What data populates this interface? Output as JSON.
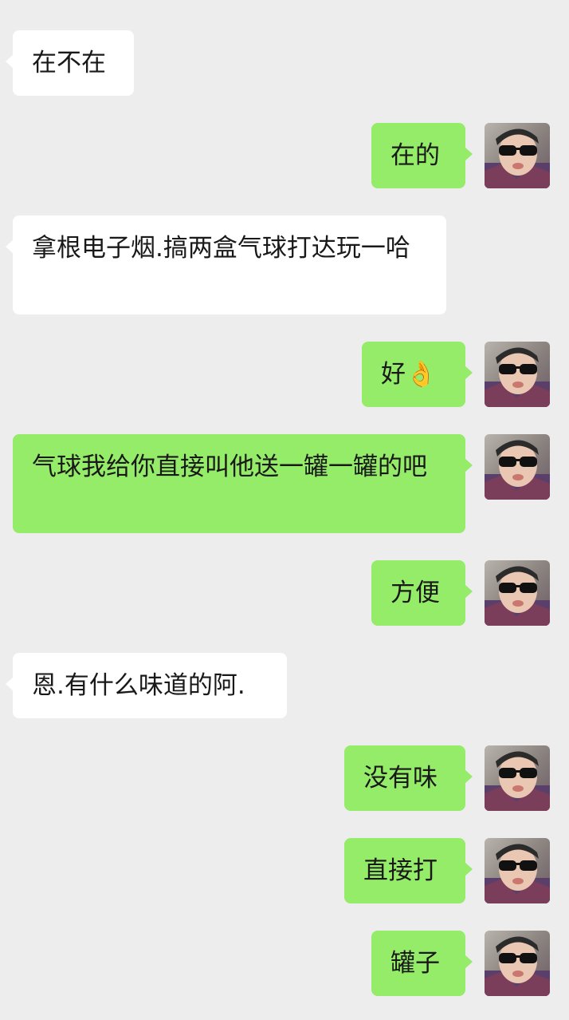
{
  "messages": [
    {
      "side": "in",
      "text": "在不在"
    },
    {
      "side": "out",
      "text": "在的"
    },
    {
      "side": "in",
      "text": "拿根电子烟.搞两盒气球打达玩一哈"
    },
    {
      "side": "out",
      "text": "好👌"
    },
    {
      "side": "out",
      "text": "气球我给你直接叫他送一罐一罐的吧"
    },
    {
      "side": "out",
      "text": "方便"
    },
    {
      "side": "in",
      "text": "恩.有什么味道的阿."
    },
    {
      "side": "out",
      "text": "没有味"
    },
    {
      "side": "out",
      "text": "直接打"
    },
    {
      "side": "out",
      "text": "罐子"
    }
  ],
  "avatar_icon": "user-avatar-sunglasses",
  "colors": {
    "background": "#ededed",
    "incoming": "#ffffff",
    "outgoing": "#95ec69"
  }
}
